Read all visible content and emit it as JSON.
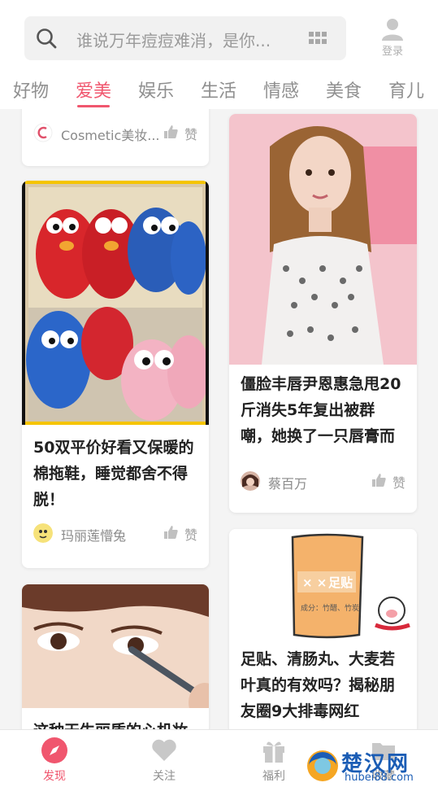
{
  "search": {
    "placeholder": "谁说万年痘痘难消，是你..."
  },
  "login_label": "登录",
  "tabs": [
    {
      "label": "好物"
    },
    {
      "label": "爱美"
    },
    {
      "label": "娱乐"
    },
    {
      "label": "生活"
    },
    {
      "label": "情感"
    },
    {
      "label": "美食"
    },
    {
      "label": "育儿"
    }
  ],
  "active_tab": "爱美",
  "cards": {
    "cosmetic": {
      "author": "Cosmetic美妆...",
      "like": "赞"
    },
    "slippers": {
      "title": "50双平价好看又保暖的棉拖鞋，睡觉都舍不得脱！",
      "author": "玛丽莲懵兔",
      "like": "赞"
    },
    "makeup": {
      "title": "这种天生丽质的心机妆"
    },
    "celebrity": {
      "title": "僵脸丰唇尹恩惠急甩20斤消失5年复出被群嘲，她换了一只唇膏而",
      "author": "蔡百万",
      "like": "赞"
    },
    "patch": {
      "title": "足贴、清肠丸、大麦若叶真的有效吗？揭秘朋友圈9大排毒网红",
      "package_text": "足贴",
      "package_sub": "成分：竹醋、竹炭"
    }
  },
  "bottom_nav": [
    {
      "label": "发现"
    },
    {
      "label": "关注"
    },
    {
      "label": "福利"
    },
    {
      "label": "收藏"
    }
  ],
  "watermark": {
    "line1": "楚汉网",
    "line2": "hubei88.com"
  },
  "colors": {
    "accent": "#f0566e",
    "text_muted": "#8f8f8f"
  }
}
